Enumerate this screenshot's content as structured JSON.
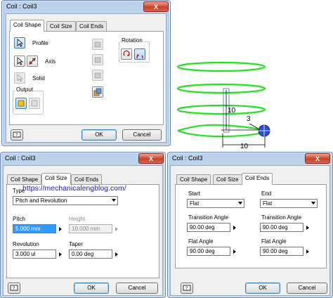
{
  "dialog_top": {
    "title": "Coil : Coil3",
    "tabs": [
      "Coil Shape",
      "Coil Size",
      "Coil Ends"
    ],
    "profile_label": "Profile",
    "axis_label": "Axis",
    "solid_label": "Solid",
    "output_label": "Output",
    "rotation_label": "Rotation",
    "ok_label": "OK",
    "cancel_label": "Cancel",
    "close_glyph": "X"
  },
  "dialog_size": {
    "title": "Coil : Coil3",
    "tabs": [
      "Coil Shape",
      "Coil Size",
      "Coil Ends"
    ],
    "type_label": "Type",
    "type_value": "Pitch and Revolution",
    "pitch_label": "Pitch",
    "pitch_value": "5.000 mm",
    "height_label": "Height",
    "height_value": "10.000 mm",
    "revolution_label": "Revolution",
    "revolution_value": "3.000 ul",
    "taper_label": "Taper",
    "taper_value": "0.00 deg",
    "ok_label": "OK",
    "cancel_label": "Cancel",
    "close_glyph": "X"
  },
  "dialog_ends": {
    "title": "Coil : Coil3",
    "tabs": [
      "Coil Shape",
      "Coil Size",
      "Coil Ends"
    ],
    "start_label": "Start",
    "start_value": "Flat",
    "start_transition_label": "Transition Angle",
    "start_transition_value": "90.00 deg",
    "start_flat_label": "Flat Angle",
    "start_flat_value": "90.00 deg",
    "end_label": "End",
    "end_value": "Flat",
    "end_transition_label": "Transition Angle",
    "end_transition_value": "90.00 deg",
    "end_flat_label": "Flat Angle",
    "end_flat_value": "90.00 deg",
    "ok_label": "OK",
    "cancel_label": "Cancel",
    "close_glyph": "X"
  },
  "watermark": "https://mechanicalengblog.com/",
  "viewport": {
    "dim_height": "10",
    "dim_width": "10",
    "dim_radius": "3",
    "coil_color": "#22e022",
    "dim_color": "#000000"
  },
  "colors": {
    "frame": "#bcd1ea",
    "close": "#c7432b",
    "selection": "#3399ff",
    "link": "#1a1acc"
  }
}
